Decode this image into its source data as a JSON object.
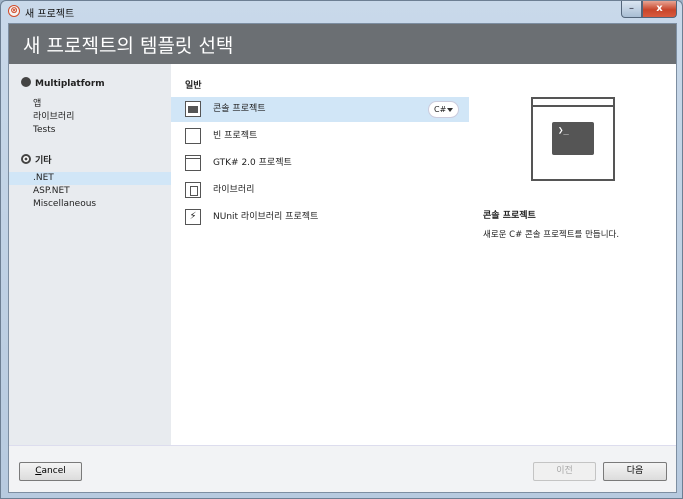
{
  "window": {
    "title": "새 프로젝트",
    "minimize_glyph": "–",
    "close_glyph": "x"
  },
  "header": {
    "title": "새 프로젝트의 템플릿 선택"
  },
  "sidebar": {
    "categories": [
      {
        "label": "Multiplatform",
        "icon": "multiplatform-icon",
        "items": [
          "앱",
          "라이브러리",
          "Tests"
        ]
      },
      {
        "label": "기타",
        "icon": "other-icon",
        "items": [
          ".NET",
          "ASP.NET",
          "Miscellaneous"
        ]
      }
    ],
    "selected_item": ".NET"
  },
  "templates": {
    "section_label": "일반",
    "items": [
      {
        "label": "콘솔 프로젝트",
        "icon": "console-icon"
      },
      {
        "label": "빈 프로젝트",
        "icon": "blank-icon"
      },
      {
        "label": "GTK# 2.0 프로젝트",
        "icon": "gtk-window-icon"
      },
      {
        "label": "라이브러리",
        "icon": "library-icon"
      },
      {
        "label": "NUnit 라이브러리 프로젝트",
        "icon": "nunit-icon"
      }
    ],
    "selected": "콘솔 프로젝트",
    "language": "C#"
  },
  "preview": {
    "terminal_glyph": "❯_",
    "title": "콘솔 프로젝트",
    "description": "새로운 C# 콘솔 프로젝트를 만듭니다."
  },
  "footer": {
    "cancel_label_underlined": "C",
    "cancel_label_rest": "ancel",
    "previous_label": "이전",
    "next_label": "다음"
  }
}
